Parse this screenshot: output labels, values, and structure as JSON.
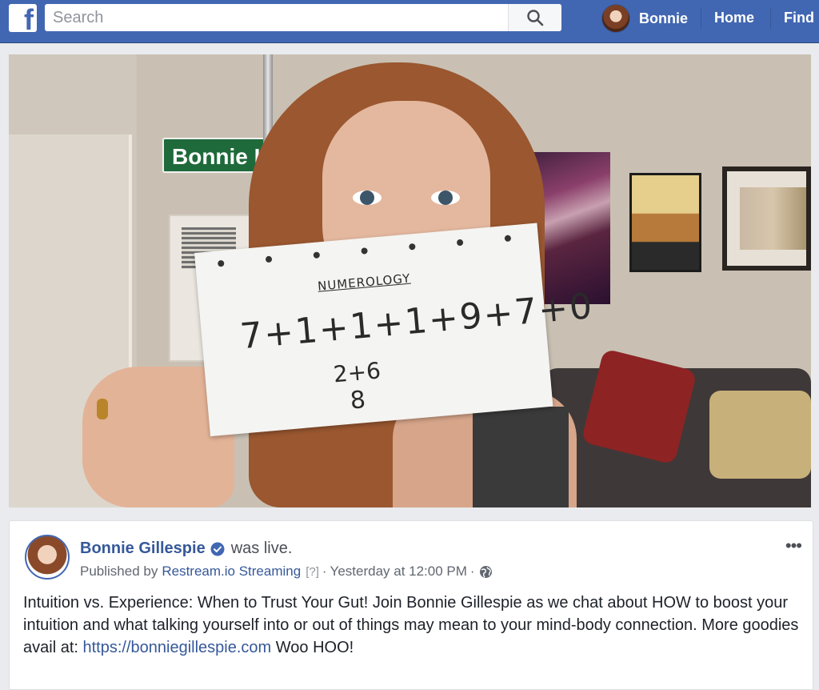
{
  "topbar": {
    "logo_glyph": "f",
    "search_placeholder": "Search",
    "search_icon": "search-icon",
    "user_name": "Bonnie",
    "nav_home": "Home",
    "nav_find": "Find",
    "brand_color": "#4267b2"
  },
  "video": {
    "street_sign_text": "Bonnie L",
    "note_title": "NUMEROLOGY",
    "note_equation": "7+1+1+1+9+7+0",
    "note_sum": "2+6",
    "note_result": "8"
  },
  "post": {
    "author": "Bonnie Gillespie",
    "verified_icon": "verified-badge-icon",
    "status": "was live.",
    "published_by_prefix": "Published by",
    "publisher": "Restream.io Streaming",
    "help_marker": "[?]",
    "separator": "·",
    "timestamp": "Yesterday at 12:00 PM",
    "privacy_icon": "globe-icon",
    "more_icon": "•••",
    "body_part1": "Intuition vs. Experience: When to Trust Your Gut! Join Bonnie Gillespie as we chat about HOW to boost your intuition and what talking yourself into or out of things may mean to your mind-body connection. More goodies avail at: ",
    "body_link": "https://bonniegillespie.com",
    "body_part2": " Woo HOO!"
  }
}
